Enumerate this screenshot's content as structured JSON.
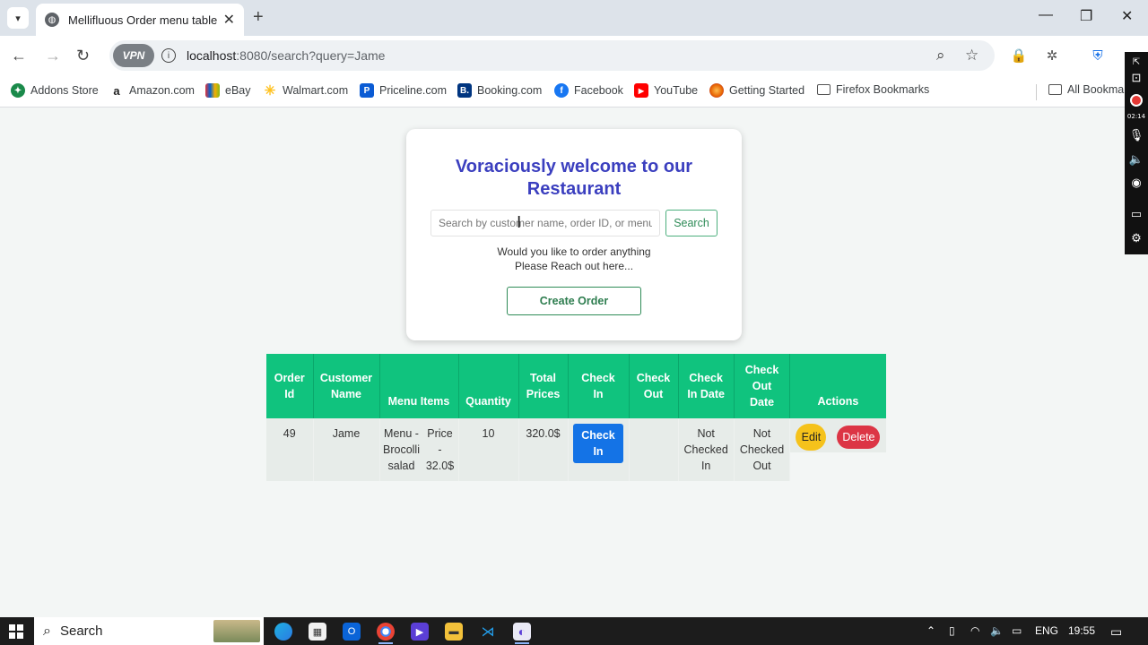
{
  "browser": {
    "tab_title": "Mellifluous Order menu table",
    "url_host": "localhost",
    "url_path": ":8080/search?query=Jame",
    "vpn_label": "VPN"
  },
  "bookmarks": [
    {
      "label": "Addons Store",
      "icon": "addons-icon",
      "color": "#1a8a4a"
    },
    {
      "label": "Amazon.com",
      "icon": "amazon-icon",
      "color": "#222"
    },
    {
      "label": "eBay",
      "icon": "ebay-icon",
      "color": "#e53238"
    },
    {
      "label": "Walmart.com",
      "icon": "walmart-icon",
      "color": "#ffc220"
    },
    {
      "label": "Priceline.com",
      "icon": "priceline-icon",
      "color": "#0a5bd4"
    },
    {
      "label": "Booking.com",
      "icon": "booking-icon",
      "color": "#003580"
    },
    {
      "label": "Facebook",
      "icon": "facebook-icon",
      "color": "#1877f2"
    },
    {
      "label": "YouTube",
      "icon": "youtube-icon",
      "color": "#ff0000"
    },
    {
      "label": "Getting Started",
      "icon": "firefox-icon",
      "color": "#e66000"
    },
    {
      "label": "Firefox Bookmarks",
      "icon": "folder-icon",
      "color": "#555"
    },
    {
      "label": "All Bookmarks",
      "icon": "folder-icon",
      "color": "#555"
    }
  ],
  "recorder": {
    "time": "02:14"
  },
  "card": {
    "title_line1": "Voraciously welcome to our",
    "title_line2": "Restaurant",
    "search_placeholder": "Search by customer name, order ID, or menu items",
    "search_button": "Search",
    "message_line1": "Would you like to order anything",
    "message_line2": "Please Reach out here...",
    "create_button": "Create Order"
  },
  "table": {
    "headers": {
      "order_id": [
        "Order",
        "Id"
      ],
      "customer_name": [
        "Customer",
        "Name"
      ],
      "menu_items": [
        "Menu Items"
      ],
      "quantity": [
        "Quantity"
      ],
      "total_prices": [
        "Total",
        "Prices"
      ],
      "check_in": [
        "Check",
        "In"
      ],
      "check_out": [
        "Check",
        "Out"
      ],
      "check_in_date": [
        "Check",
        "In Date"
      ],
      "check_out_date": [
        "Check",
        "Out",
        "Date"
      ],
      "actions": [
        "Actions"
      ]
    },
    "rows": [
      {
        "order_id": "49",
        "customer_name": "Jame",
        "menu_name_lines": [
          "Menu -",
          "Brocolli",
          "salad"
        ],
        "menu_price_lines": [
          "Price",
          "-",
          "32.0$"
        ],
        "quantity": "10",
        "total_price": "320.0$",
        "check_in_button": [
          "Check",
          "In"
        ],
        "check_out": "",
        "check_in_date": [
          "Not",
          "Checked",
          "In"
        ],
        "check_out_date": [
          "Not",
          "Checked",
          "Out"
        ],
        "edit_label": "Edit",
        "delete_label": "Delete"
      }
    ]
  },
  "taskbar": {
    "search_label": "Search",
    "language": "ENG",
    "time": "19:55"
  }
}
